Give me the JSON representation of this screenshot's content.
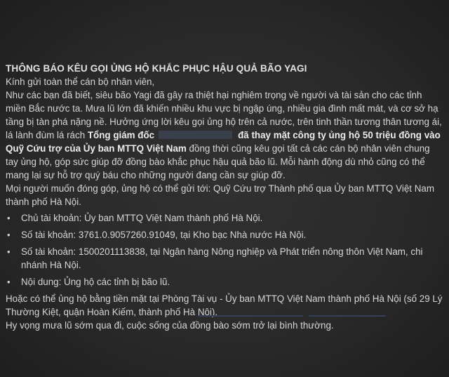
{
  "notice": {
    "title": "THÔNG BÁO KÊU GỌI ỦNG HỘ KHẮC PHỤC HẬU QUẢ BÃO YAGI",
    "greeting": "Kính gửi toàn thể cán bộ nhân viên,",
    "intro": "Như các bạn đã biết, siêu bão Yagi đã gây ra thiệt hại nghiêm trọng về người và tài sản cho các tỉnh miền Bắc nước ta. Mưa lũ lớn đã khiến nhiều khu vực bị ngập úng, nhiều gia đình mất mát, và cơ sở hạ tầng bị tàn phá nặng nề. Hưởng ứng lời kêu gọi ủng hộ trên cả nước, trên tinh thần tương thân tương ái, lá lành đùm lá rách",
    "bold_prefix": "Tổng giám đốc",
    "bold_suffix": "đã thay mặt công ty ủng hộ 50 triệu đồng vào Quỹ Cứu trợ của Ủy ban MTTQ Việt Nam",
    "after_bold": "đồng thời cũng kêu gọi tất cả các cán bộ nhân viên chung tay ủng hộ, góp sức giúp đỡ đồng bào khắc phục hậu quả bão lũ. Mỗi hành động dù nhỏ cũng có thể mang lại sự hỗ trợ quý báu cho những người đang cần sự giúp đỡ.",
    "contribute": "Mọi người muốn đóng góp, ủng hộ có thể gửi tới: Quỹ Cứu trợ Thành phố qua Ủy ban MTTQ Việt Nam thành phố Hà Nội.",
    "items": [
      "Chủ tài khoản: Ủy ban MTTQ Việt Nam thành phố Hà Nội.",
      "Số tài khoản: 3761.0.9057260.91049, tại Kho bạc Nhà nước Hà Nội.",
      "Số tài khoản: 1500201113838, tại Ngân hàng Nông nghiệp và Phát triển nông thôn Việt Nam, chi nhánh Hà Nội.",
      "Nội dung: Ủng hộ các tỉnh bị bão lũ."
    ],
    "cash": "Hoặc có thể ủng hộ bằng tiền mặt tại Phòng Tài vụ - Ủy ban MTTQ Việt Nam thành phố Hà Nội (số 29 Lý Thường Kiệt, quận Hoàn Kiếm, thành phố Hà Nội).",
    "closing": "Hy vọng mưa lũ sớm qua đi, cuộc sống của đồng bào sớm trở lại bình thường."
  },
  "colors": {
    "background": "#2a2a2a",
    "text": "#d6d6d6",
    "redaction": "#3a3f4c"
  }
}
